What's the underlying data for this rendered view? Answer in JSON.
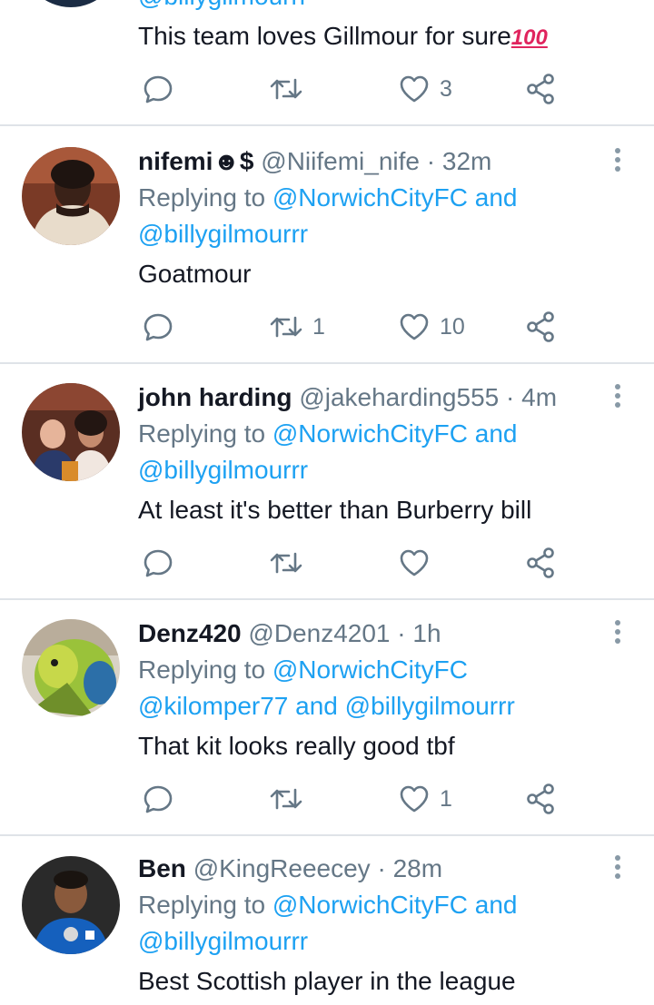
{
  "top_tweet": {
    "handle_partial": "@billygilmourrr",
    "text": "This team loves Gillmour for sure",
    "emoji": "100",
    "actions": {
      "reply_count": "",
      "retweet_count": "",
      "like_count": "3"
    }
  },
  "tweets": [
    {
      "name": "nifemi☻$",
      "handle": "@Niifemi_nife",
      "time": "32m",
      "replying_prefix": "Replying to",
      "reply_line1_mention": "@NorwichCityFC",
      "reply_line1_suffix": "and",
      "reply_line2": "@billygilmourrr",
      "text": "Goatmour",
      "retweet_count": "1",
      "like_count": "10"
    },
    {
      "name": "john harding",
      "handle": "@jakeharding555",
      "time": "4m",
      "replying_prefix": "Replying to",
      "reply_line1_mention": "@NorwichCityFC",
      "reply_line1_suffix": "and",
      "reply_line2": "@billygilmourrr",
      "text": "At least it's better than Burberry bill",
      "retweet_count": "",
      "like_count": ""
    },
    {
      "name": "Denz420",
      "handle": "@Denz4201",
      "time": "1h",
      "replying_prefix": "Replying to",
      "reply_line1_mention": "@NorwichCityFC",
      "reply_line1_suffix": "",
      "reply_line2_a": "@kilomper77",
      "reply_line2_and": "and",
      "reply_line2_b": "@billygilmourrr",
      "text": "That kit looks really good tbf",
      "retweet_count": "",
      "like_count": "1"
    },
    {
      "name": "Ben",
      "handle": "@KingReeecey",
      "time": "28m",
      "replying_prefix": "Replying to",
      "reply_line1_mention": "@NorwichCityFC",
      "reply_line1_suffix": "and",
      "reply_line2": "@billygilmourrr",
      "text": "Best Scottish player in the league"
    }
  ],
  "separator": "·",
  "colors": {
    "link": "#1da1f2",
    "secondary": "#657786",
    "divider": "#dfe3e8"
  }
}
